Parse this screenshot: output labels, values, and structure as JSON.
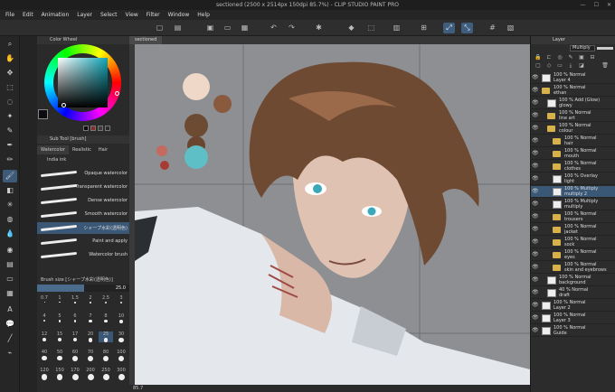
{
  "titlebar": {
    "title": "sectioned (2500 x 2514px 150dpi 85.7%) - CLIP STUDIO PAINT PRO"
  },
  "menubar": {
    "items": [
      "File",
      "Edit",
      "Animation",
      "Layer",
      "Select",
      "View",
      "Filter",
      "Window",
      "Help"
    ]
  },
  "command_bar": {
    "icons": [
      "new-document-icon",
      "open-icon",
      "save-icon",
      "undo-icon",
      "redo-icon",
      "clear-icon",
      "fill-icon",
      "transform-icon",
      "hide-selection-icon",
      "vector-snap-icon",
      "ruler-snap-icon"
    ]
  },
  "tools": [
    "zoom-icon",
    "move-icon",
    "hand-icon",
    "selection-icon",
    "lasso-icon",
    "wand-icon",
    "eyedropper-icon",
    "pen-icon",
    "pencil-icon",
    "brush-icon",
    "airbrush-icon",
    "eraser-icon",
    "decoration-icon",
    "blend-icon",
    "fill-tool-icon",
    "gradient-icon",
    "figure-icon",
    "frame-icon",
    "text-icon",
    "balloon-icon",
    "line-icon",
    "correction-icon",
    "ruler-icon",
    "operation-icon"
  ],
  "left_panel": {
    "color_wheel_title": "Color Wheel",
    "sub_tool_header": "Sub Tool [brush]",
    "sub_tool_tabs": [
      "Watercolor",
      "Realistic",
      "Hair"
    ],
    "indialink_label": "India ink",
    "brushes": [
      "Opaque watercolor",
      "Transparent watercolor",
      "Dense watercolor",
      "Smooth watercolor",
      "シャープ水彩(透明色)",
      "Paint and apply",
      "Watercolor brush"
    ],
    "brush_size_header": "Brush size [シャープ水彩(透明色)]",
    "brush_size_value": "25.0",
    "size_presets": [
      "0.7",
      "1",
      "1.5",
      "2",
      "2.5",
      "3",
      "4",
      "5",
      "6",
      "7",
      "8",
      "10",
      "12",
      "15",
      "17",
      "20",
      "25",
      "30",
      "40",
      "50",
      "60",
      "70",
      "80",
      "100",
      "120",
      "150",
      "170",
      "200",
      "250",
      "300"
    ],
    "selected_size": "25",
    "colors": {
      "main": "#0b0b12",
      "sub": "#ffffff"
    }
  },
  "canvas": {
    "tab_label": "sectioned",
    "status_zoom": "85.7",
    "palette_swatches": [
      "#f0d8c8",
      "#8a5a3f",
      "#6d4a32",
      "#6a4630",
      "#c56a5e",
      "#a83c35",
      "#5fbfc6"
    ]
  },
  "layer_panel": {
    "title": "Layer",
    "blend_mode": "Multiply",
    "opacity": "100",
    "layers": [
      {
        "line1": "100 % Normal",
        "line2": "Layer 4",
        "type": "layer",
        "indent": 0
      },
      {
        "line1": "100 % Normal",
        "line2": "ethan",
        "type": "folder",
        "indent": 0
      },
      {
        "line1": "100 % Add (Glow)",
        "line2": "glowy",
        "type": "layer",
        "indent": 1
      },
      {
        "line1": "100 % Normal",
        "line2": "line art",
        "type": "folder",
        "indent": 1
      },
      {
        "line1": "100 % Normal",
        "line2": "colour",
        "type": "folder",
        "indent": 1
      },
      {
        "line1": "100 % Normal",
        "line2": "hair",
        "type": "folder",
        "indent": 2
      },
      {
        "line1": "100 % Normal",
        "line2": "mouth",
        "type": "folder",
        "indent": 2
      },
      {
        "line1": "100 % Normal",
        "line2": "clothes",
        "type": "folder",
        "indent": 2
      },
      {
        "line1": "100 % Overlay",
        "line2": "light",
        "type": "layer",
        "indent": 2
      },
      {
        "line1": "100 % Multiply",
        "line2": "multiply 2",
        "type": "layer",
        "indent": 2,
        "selected": true
      },
      {
        "line1": "100 % Multiply",
        "line2": "multiply",
        "type": "layer",
        "indent": 2
      },
      {
        "line1": "100 % Normal",
        "line2": "trousers",
        "type": "folder",
        "indent": 2
      },
      {
        "line1": "100 % Normal",
        "line2": "jacket",
        "type": "folder",
        "indent": 2
      },
      {
        "line1": "100 % Normal",
        "line2": "sock",
        "type": "folder",
        "indent": 2
      },
      {
        "line1": "100 % Normal",
        "line2": "eyes",
        "type": "folder",
        "indent": 2
      },
      {
        "line1": "100 % Normal",
        "line2": "skin and eyebrows",
        "type": "folder",
        "indent": 2
      },
      {
        "line1": "100 % Normal",
        "line2": "background",
        "type": "layer",
        "indent": 1
      },
      {
        "line1": "40 % Normal",
        "line2": "draft",
        "type": "layer",
        "indent": 1
      },
      {
        "line1": "100 % Normal",
        "line2": "Layer 2",
        "type": "layer",
        "indent": 0
      },
      {
        "line1": "100 % Normal",
        "line2": "Layer 3",
        "type": "layer",
        "indent": 0
      },
      {
        "line1": "100 % Normal",
        "line2": "Guide",
        "type": "layer",
        "indent": 0
      }
    ]
  }
}
